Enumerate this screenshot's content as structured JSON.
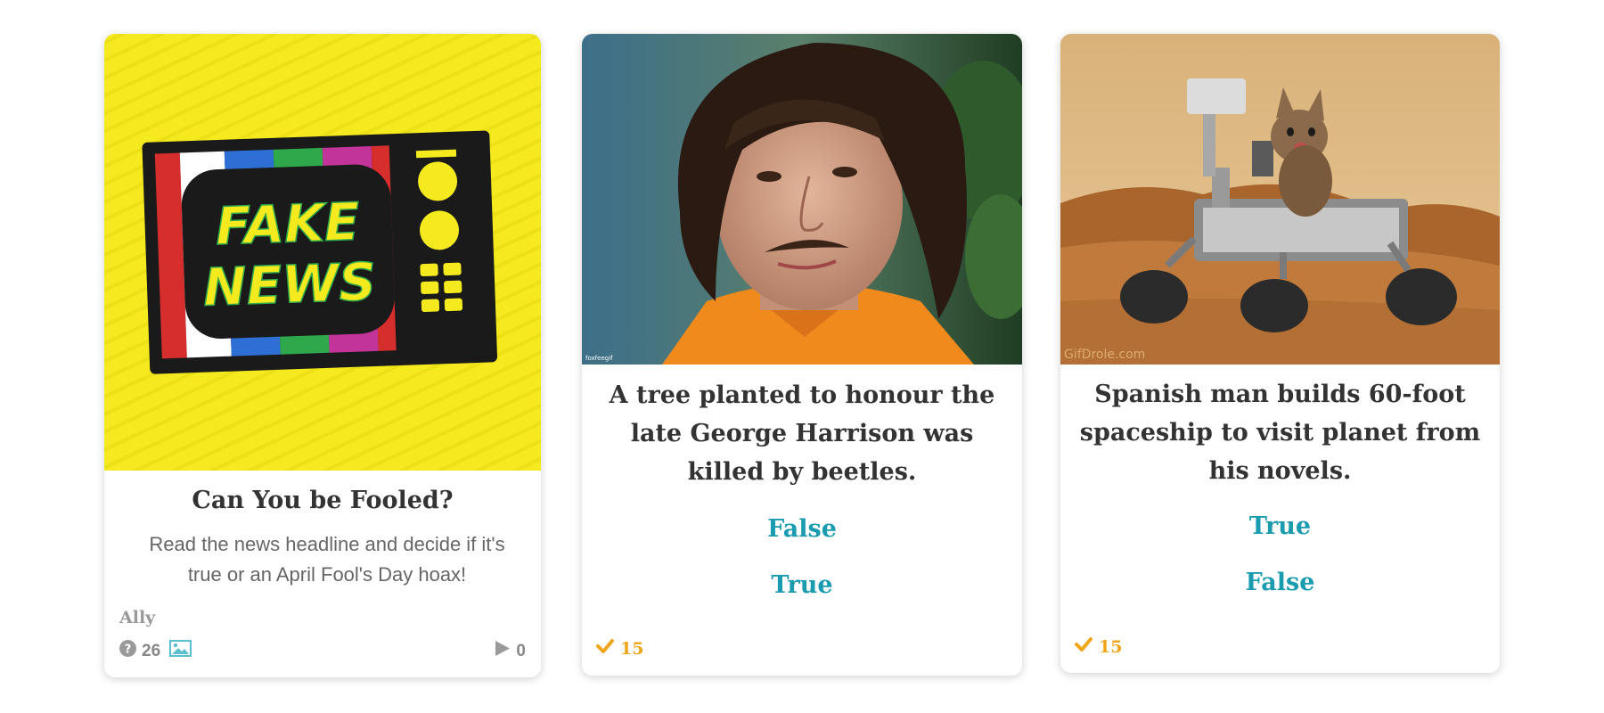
{
  "cards": [
    {
      "image": {
        "icon": "fake-news-tv-illustration",
        "text_line1": "FAKE",
        "text_line2": "NEWS",
        "background": "#f4ea1e"
      },
      "title": "Can You be Fooled?",
      "description": "Read the news headline and decide if it's true or an April Fool's Day hoax!",
      "author": "Ally",
      "question_count": "26",
      "play_count": "0",
      "colors": {
        "icon": "#9a9a9a",
        "image_icon": "#5bbfcf"
      }
    },
    {
      "image": {
        "icon": "portrait-photo",
        "watermark": "foxfeegif"
      },
      "title": "A tree planted to honour the late George Harrison was killed by beetles.",
      "answers": [
        "False",
        "True"
      ],
      "score": "15"
    },
    {
      "image": {
        "icon": "mars-rover-with-kitten-photo",
        "watermark": "GifDrole.com"
      },
      "title": "Spanish man builds 60-foot spaceship to visit planet from his novels.",
      "answers": [
        "True",
        "False"
      ],
      "score": "15"
    }
  ],
  "colors": {
    "accent": "#1a9bb0",
    "check": "#f0a51a",
    "title": "#333333"
  }
}
